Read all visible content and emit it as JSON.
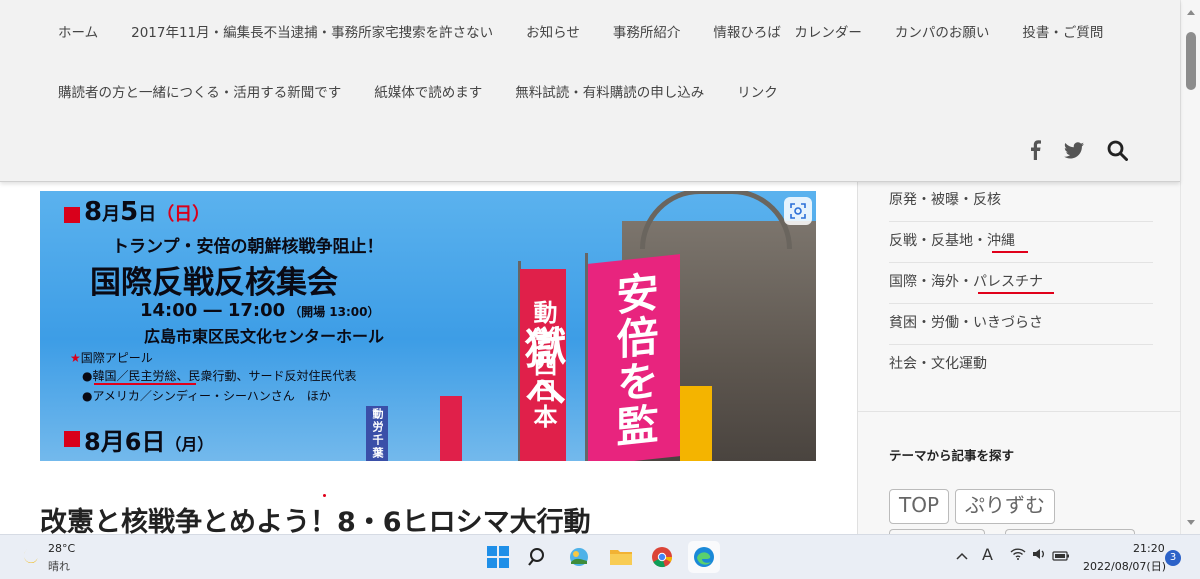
{
  "nav": {
    "row1": [
      "ホーム",
      "2017年11月・編集長不当逮捕・事務所家宅捜索を許さない",
      "お知らせ",
      "事務所紹介",
      "情報ひろば　カレンダー",
      "カンパのお願い",
      "投書・ご質問"
    ],
    "row2": [
      "購読者の方と一緒につくる・活用する新聞です",
      "紙媒体で読めます",
      "無料試読・有料購読の申し込み",
      "リンク"
    ],
    "social_icons": [
      "facebook-icon",
      "twitter-icon",
      "search-icon"
    ]
  },
  "sidebar": {
    "categories": [
      "原発・被曝・反核",
      "反戦・反基地・沖縄",
      "国際・海外・パレスチナ",
      "貧困・労働・いきづらさ",
      "社会・文化運動"
    ],
    "heading": "テーマから記事を探す",
    "tags": [
      "TOP",
      "ぷりずむ"
    ]
  },
  "banner": {
    "date1_num": "8",
    "date1_month": "月",
    "date1_day": "5",
    "date1_day_char": "日",
    "date1_weekday": "（日）",
    "subtitle": "トランプ・安倍の朝鮮核戦争阻止！",
    "event": "国際反戦反核集会",
    "time": "14:00 ― 17:00",
    "open": "（開場 13:00）",
    "venue": "広島市東区民文化センターホール",
    "appeal_title": "国際アピール",
    "appeal_line1": "●韓国／民主労総、民衆行動、サード反対住民代表",
    "appeal_line2": "●アメリカ／シンディー・シーハンさん　ほか",
    "date2": "8月6日",
    "date2_weekday": "（月）",
    "flag_left": "動労西日本",
    "flag_right": "安倍を監獄へ",
    "flag_small": "動労千葉"
  },
  "article": {
    "title": "改憲と核戦争とめよう！8・6ヒロシマ大行動"
  },
  "taskbar": {
    "temp": "28°C",
    "weather": "晴れ",
    "time": "21:20",
    "date": "2022/08/07(日)",
    "notifications": "3",
    "ime": "A",
    "apps": [
      "start-icon",
      "search-icon",
      "photos-icon",
      "file-explorer-icon",
      "chrome-icon",
      "edge-icon"
    ]
  },
  "colors": {
    "accent_red": "#e0001a",
    "banner_sky": "#3d9de6",
    "header_bg": "#f2f2f2"
  }
}
